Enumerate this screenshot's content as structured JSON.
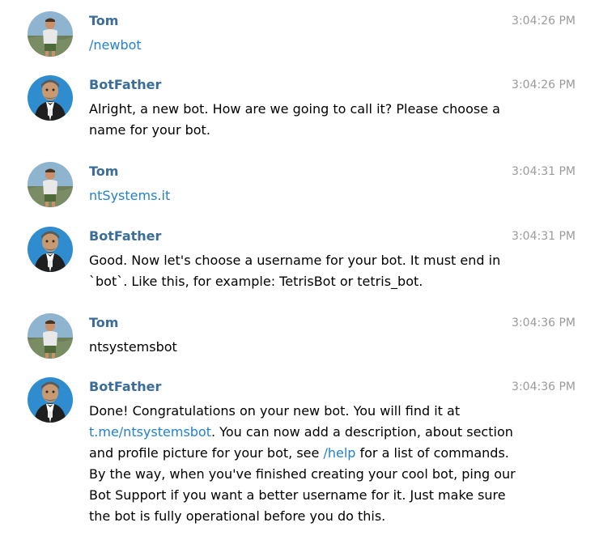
{
  "colors": {
    "sender_name": "#3a6d99",
    "link": "#2481cc",
    "timestamp": "#9a9a9a",
    "body_text": "#000000"
  },
  "messages": [
    {
      "sender": "Tom",
      "avatar": "tom-avatar",
      "time": "3:04:26 PM",
      "lines": [
        [
          {
            "text": "/newbot",
            "link": true
          }
        ]
      ]
    },
    {
      "sender": "BotFather",
      "avatar": "botfather-avatar",
      "time": "3:04:26 PM",
      "lines": [
        [
          {
            "text": "Alright, a new bot. How are we going to call it? Please choose a"
          }
        ],
        [
          {
            "text": "name for your bot."
          }
        ]
      ]
    },
    {
      "sender": "Tom",
      "avatar": "tom-avatar",
      "time": "3:04:31 PM",
      "lines": [
        [
          {
            "text": "ntSystems.it",
            "link": true
          }
        ]
      ]
    },
    {
      "sender": "BotFather",
      "avatar": "botfather-avatar",
      "time": "3:04:31 PM",
      "lines": [
        [
          {
            "text": "Good. Now let's choose a username for your bot. It must end in"
          }
        ],
        [
          {
            "text": "`bot`. Like this, for example: TetrisBot or tetris_bot."
          }
        ]
      ]
    },
    {
      "sender": "Tom",
      "avatar": "tom-avatar",
      "time": "3:04:36 PM",
      "lines": [
        [
          {
            "text": "ntsystemsbot"
          }
        ]
      ]
    },
    {
      "sender": "BotFather",
      "avatar": "botfather-avatar",
      "time": "3:04:36 PM",
      "lines": [
        [
          {
            "text": "Done! Congratulations on your new bot. You will find it at"
          }
        ],
        [
          {
            "text": "t.me/ntsystemsbot",
            "link": true
          },
          {
            "text": ". You can now add a description, about section"
          }
        ],
        [
          {
            "text": "and profile picture for your bot, see "
          },
          {
            "text": "/help",
            "link": true
          },
          {
            "text": " for a list of commands."
          }
        ],
        [
          {
            "text": "By the way, when you've finished creating your cool bot, ping our"
          }
        ],
        [
          {
            "text": "Bot Support if you want a better username for it. Just make sure"
          }
        ],
        [
          {
            "text": "the bot is fully operational before you do this."
          }
        ]
      ]
    }
  ]
}
